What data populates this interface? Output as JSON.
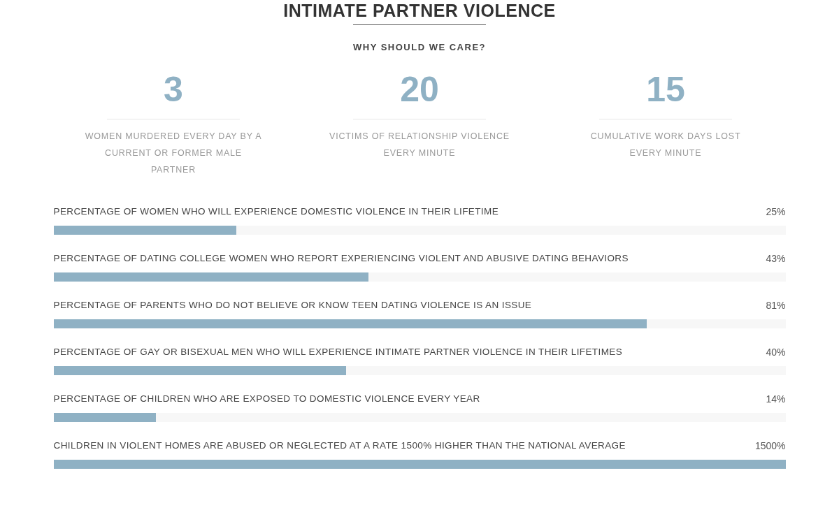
{
  "title": "INTIMATE PARTNER VIOLENCE",
  "subtitle": "WHY SHOULD WE CARE?",
  "stats": [
    {
      "number": "3",
      "description": "WOMEN MURDERED EVERY DAY BY A CURRENT OR FORMER MALE PARTNER"
    },
    {
      "number": "20",
      "description": "VICTIMS OF RELATIONSHIP VIOLENCE EVERY MINUTE"
    },
    {
      "number": "15",
      "description": "CUMULATIVE WORK DAYS LOST EVERY MINUTE"
    }
  ],
  "bars": [
    {
      "label": "PERCENTAGE OF WOMEN WHO WILL EXPERIENCE DOMESTIC VIOLENCE IN THEIR LIFETIME",
      "reading": "25%",
      "level": 0.25
    },
    {
      "label": "PERCENTAGE OF DATING COLLEGE WOMEN WHO REPORT EXPERIENCING VIOLENT AND ABUSIVE DATING BEHAVIORS",
      "reading": "43%",
      "level": 0.43
    },
    {
      "label": "PERCENTAGE OF PARENTS WHO DO NOT BELIEVE OR KNOW TEEN DATING VIOLENCE IS AN ISSUE",
      "reading": "81%",
      "level": 0.81
    },
    {
      "label": "PERCENTAGE OF GAY OR BISEXUAL MEN WHO WILL EXPERIENCE INTIMATE PARTNER VIOLENCE IN THEIR LIFETIMES",
      "reading": "40%",
      "level": 0.4
    },
    {
      "label": "PERCENTAGE OF CHILDREN WHO ARE EXPOSED TO DOMESTIC VIOLENCE EVERY YEAR",
      "reading": "14%",
      "level": 0.14
    },
    {
      "label": "CHILDREN IN VIOLENT HOMES ARE ABUSED OR NEGLECTED AT A RATE 1500% HIGHER THAN THE NATIONAL AVERAGE",
      "reading": "1500%",
      "level": 1
    }
  ]
}
